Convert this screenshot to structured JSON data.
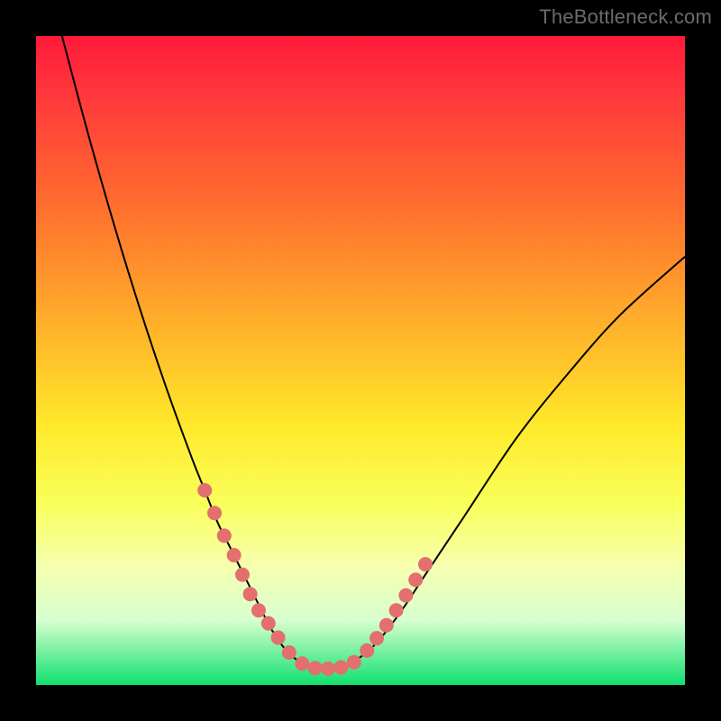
{
  "attribution": "TheBottleneck.com",
  "colors": {
    "page_bg": "#000000",
    "gradient_top": "#ff1a3a",
    "gradient_mid": "#ffe92a",
    "gradient_bottom": "#10e070",
    "curve": "#000000",
    "marker": "#e36f6f"
  },
  "chart_data": {
    "type": "line",
    "title": "",
    "xlabel": "",
    "ylabel": "",
    "xlim": [
      0,
      100
    ],
    "ylim": [
      0,
      100
    ],
    "grid": false,
    "legend": false,
    "series": [
      {
        "name": "curve",
        "x": [
          4,
          8,
          12,
          16,
          20,
          24,
          26,
          28,
          30,
          32,
          34,
          35,
          36,
          37,
          38,
          40,
          42,
          44,
          46,
          48,
          52,
          56,
          60,
          66,
          74,
          82,
          90,
          100
        ],
        "y": [
          100,
          85,
          71,
          58,
          46,
          35,
          30,
          25,
          21,
          17,
          13,
          11,
          9,
          7.5,
          6,
          4,
          3,
          2.5,
          2.5,
          3,
          6,
          11,
          17,
          26,
          38,
          48,
          57,
          66
        ]
      }
    ],
    "markers": {
      "name": "highlight-points",
      "x": [
        26,
        27.5,
        29,
        30.5,
        31.8,
        33,
        34.3,
        35.8,
        37.3,
        39,
        41,
        43,
        45,
        47,
        49,
        51,
        52.5,
        54,
        55.5,
        57,
        58.5,
        60
      ],
      "y": [
        30,
        26.5,
        23,
        20,
        17,
        14,
        11.5,
        9.5,
        7.3,
        5,
        3.3,
        2.6,
        2.5,
        2.7,
        3.5,
        5.3,
        7.2,
        9.2,
        11.5,
        13.8,
        16.2,
        18.6
      ]
    }
  }
}
